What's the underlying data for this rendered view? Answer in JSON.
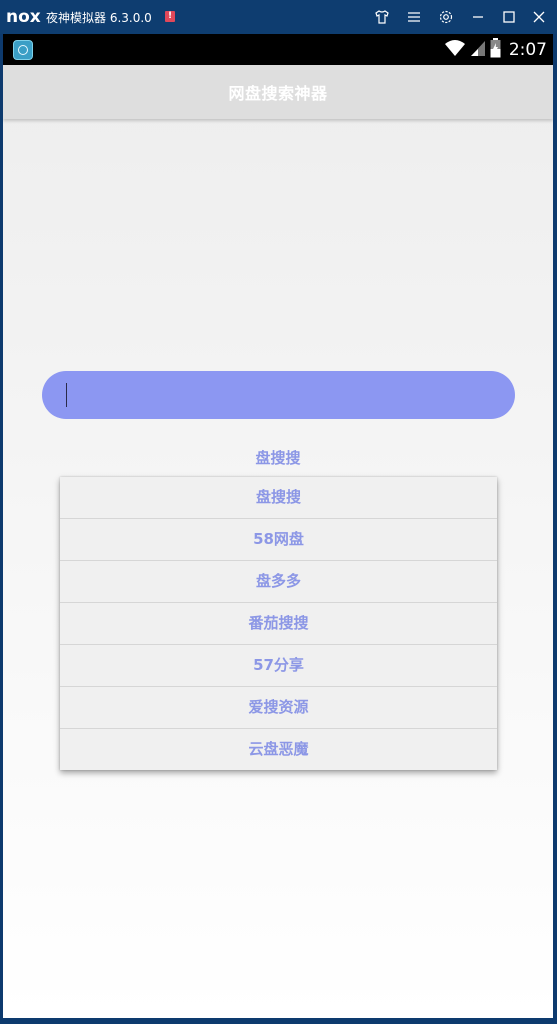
{
  "emulator": {
    "logo": "nox",
    "title": "夜神模拟器 6.3.0.0",
    "badge": "!",
    "controls": [
      "skin-icon",
      "menu-icon",
      "settings-icon",
      "minimize-icon",
      "maximize-icon",
      "close-icon"
    ]
  },
  "statusbar": {
    "time": "2:07",
    "icons": [
      "wifi-icon",
      "signal-icon",
      "battery-icon"
    ]
  },
  "appbar": {
    "title": "网盘搜索神器"
  },
  "search": {
    "value": "",
    "placeholder": ""
  },
  "engine": {
    "selected": "盘搜搜",
    "options": [
      "盘搜搜",
      "58网盘",
      "盘多多",
      "番茄搜搜",
      "57分享",
      "爱搜资源",
      "云盘恶魔"
    ]
  },
  "colors": {
    "emulator_bar": "#0e3d70",
    "appbar": "#dedede",
    "search_box": "#8c97f2",
    "accent_text": "#8c97e6",
    "dropdown_bg": "#f0f0f0"
  }
}
